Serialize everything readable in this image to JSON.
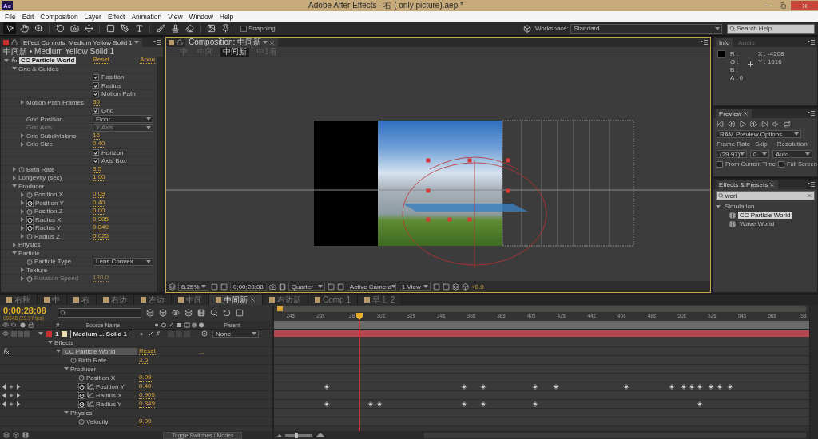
{
  "window": {
    "app_icon": "Ae",
    "title": "Adobe After Effects - 右 ( only picture).aep *"
  },
  "menu": [
    "File",
    "Edit",
    "Composition",
    "Layer",
    "Effect",
    "Animation",
    "View",
    "Window",
    "Help"
  ],
  "toolbar": {
    "snapping": {
      "label": "Snapping",
      "checked": false
    },
    "workspace_label": "Workspace:",
    "workspace": "Standard",
    "search": {
      "placeholder": "Search Help"
    }
  },
  "effect_controls": {
    "tab": "Effect Controls: Medium Yellow Solid 1",
    "subtitle": "中间新 • Medium Yellow Solid 1",
    "effect": {
      "name": "CC Particle World",
      "reset": "Reset",
      "about": "Abou"
    },
    "rows": [
      {
        "kind": "group",
        "label": "Grid & Guides",
        "expanded": true,
        "children": [
          {
            "kind": "checkbox",
            "label": "Position",
            "checked": true
          },
          {
            "kind": "checkbox",
            "label": "Radius",
            "checked": true
          },
          {
            "kind": "checkbox",
            "label": "Motion Path",
            "checked": true
          },
          {
            "kind": "value",
            "label": "Motion Path Frames",
            "value": "30",
            "stopwatch": false,
            "disabled": false
          },
          {
            "kind": "checkbox",
            "label": "Grid",
            "checked": true
          },
          {
            "kind": "dropdown",
            "label": "Grid Position",
            "value": "Floor",
            "stopwatch": false,
            "disabled": false
          },
          {
            "kind": "dropdown",
            "label": "Grid Axis",
            "value": "Y Axis",
            "stopwatch": false,
            "disabled": true
          },
          {
            "kind": "value",
            "label": "Grid Subdivisions",
            "value": "16",
            "stopwatch": false,
            "disabled": false
          },
          {
            "kind": "value",
            "label": "Grid Size",
            "value": "0.40",
            "stopwatch": false,
            "disabled": false
          },
          {
            "kind": "checkbox",
            "label": "Horizon",
            "checked": true
          },
          {
            "kind": "checkbox",
            "label": "Axis Box",
            "checked": true
          }
        ]
      },
      {
        "kind": "value",
        "label": "Birth Rate",
        "value": "3.5",
        "stopwatch": true,
        "animated": false,
        "disabled": false
      },
      {
        "kind": "value",
        "label": "Longevity (sec)",
        "value": "1.00",
        "stopwatch": false,
        "disabled": false
      },
      {
        "kind": "group",
        "label": "Producer",
        "expanded": true,
        "children": [
          {
            "kind": "value",
            "label": "Position X",
            "value": "0.09",
            "stopwatch": true,
            "animated": false,
            "disabled": false
          },
          {
            "kind": "value",
            "label": "Position Y",
            "value": "0.40",
            "stopwatch": true,
            "animated": true,
            "disabled": false
          },
          {
            "kind": "value",
            "label": "Position Z",
            "value": "0.00",
            "stopwatch": true,
            "animated": false,
            "disabled": false
          },
          {
            "kind": "value",
            "label": "Radius X",
            "value": "0.905",
            "stopwatch": true,
            "animated": true,
            "disabled": false
          },
          {
            "kind": "value",
            "label": "Radius Y",
            "value": "0.849",
            "stopwatch": true,
            "animated": true,
            "disabled": false
          },
          {
            "kind": "value",
            "label": "Radius Z",
            "value": "0.025",
            "stopwatch": true,
            "animated": false,
            "disabled": false
          }
        ]
      },
      {
        "kind": "group",
        "label": "Physics",
        "expanded": false
      },
      {
        "kind": "group",
        "label": "Particle",
        "expanded": true,
        "children": [
          {
            "kind": "dropdown",
            "label": "Particle Type",
            "value": "Lens Convex",
            "stopwatch": true,
            "animated": false,
            "disabled": false
          },
          {
            "kind": "group",
            "label": "Texture",
            "expanded": false
          },
          {
            "kind": "value",
            "label": "Rotation Speed",
            "value": "180.0",
            "stopwatch": true,
            "animated": false,
            "disabled": true
          }
        ]
      }
    ]
  },
  "composition": {
    "tab": "Composition: 中间新",
    "breadcrumbs": [
      {
        "label": "中",
        "selected": false
      },
      {
        "label": "中间",
        "selected": false
      },
      {
        "label": "中间新",
        "selected": true
      },
      {
        "label": "中1看",
        "selected": false
      }
    ],
    "footer": {
      "zoom": "6.25%",
      "time": "0;00;28;08",
      "resolution": "Quarter",
      "camera": "Active Camera",
      "views": "1 View",
      "exposure": "+0.0"
    }
  },
  "info": {
    "tabs": [
      {
        "label": "Info",
        "selected": true
      },
      {
        "label": "Audio",
        "selected": false
      }
    ],
    "channels": [
      "R :",
      "G :",
      "B :",
      "A : 0"
    ],
    "x": "X : -4208",
    "y": "Y : 1616"
  },
  "preview": {
    "tab": "Preview",
    "options": "RAM Preview Options",
    "frame_rate_label": "Frame Rate",
    "skip_label": "Skip",
    "resolution_label": "Resolution",
    "frame_rate": "(29.97)",
    "skip": "0",
    "resolution": "Auto",
    "checks": [
      {
        "label": "From Current Time",
        "checked": false
      },
      {
        "label": "Full Screen",
        "checked": false
      }
    ]
  },
  "effects_presets": {
    "tab": "Effects & Presets",
    "search": "worl",
    "tree": [
      {
        "label": "Simulation",
        "expanded": true,
        "selected": false,
        "children": [
          {
            "label": "CC Particle World",
            "selected": true
          },
          {
            "label": "Wave World",
            "selected": false
          }
        ]
      }
    ]
  },
  "timeline": {
    "tabs": [
      {
        "label": "右秋",
        "selected": false
      },
      {
        "label": "中",
        "selected": false
      },
      {
        "label": "右",
        "selected": false
      },
      {
        "label": "右边",
        "selected": false
      },
      {
        "label": "左边",
        "selected": false
      },
      {
        "label": "中间",
        "selected": false
      },
      {
        "label": "中间新",
        "selected": true
      },
      {
        "label": "右边新",
        "selected": false
      },
      {
        "label": "Comp 1",
        "selected": false
      },
      {
        "label": "早上 2",
        "selected": false
      }
    ],
    "time": "0;00;28;08",
    "fps": "00848 (29.97 fps)",
    "columns": {
      "number": "#",
      "source": "Source Name",
      "parent": "Parent"
    },
    "layer": {
      "number": "1",
      "name": "Medium ... Solid 1",
      "parent": "None",
      "expanded": true,
      "children": [
        {
          "kind": "group",
          "label": "Effects",
          "expanded": true,
          "children": [
            {
              "kind": "effect",
              "label": "CC Particle World",
              "reset": "Reset",
              "more": "...",
              "expanded": true,
              "children": [
                {
                  "kind": "property",
                  "label": "Birth Rate",
                  "value": "3.5",
                  "animated": false
                },
                {
                  "kind": "group",
                  "label": "Producer",
                  "expanded": true,
                  "children": [
                    {
                      "kind": "property",
                      "label": "Position X",
                      "value": "0.09",
                      "animated": false
                    },
                    {
                      "kind": "property",
                      "label": "Position Y",
                      "value": "0.40",
                      "animated": true
                    },
                    {
                      "kind": "property",
                      "label": "Radius X",
                      "value": "0.905",
                      "animated": true
                    },
                    {
                      "kind": "property",
                      "label": "Radius Y",
                      "value": "0.849",
                      "animated": true
                    }
                  ]
                },
                {
                  "kind": "group",
                  "label": "Physics",
                  "expanded": true,
                  "children": [
                    {
                      "kind": "property",
                      "label": "Velocity",
                      "value": "0.00",
                      "animated": false
                    }
                  ]
                }
              ]
            }
          ]
        }
      ]
    },
    "ruler": [
      "24s",
      "26s",
      "28",
      "30s",
      "32s",
      "34s",
      "36s",
      "38s",
      "40s",
      "42s",
      "44s",
      "46s",
      "48s",
      "50s",
      "52s",
      "54s",
      "56s",
      "58"
    ],
    "zoom_slider": {
      "level": 0.4
    },
    "footer": "Toggle Switches / Modes"
  }
}
